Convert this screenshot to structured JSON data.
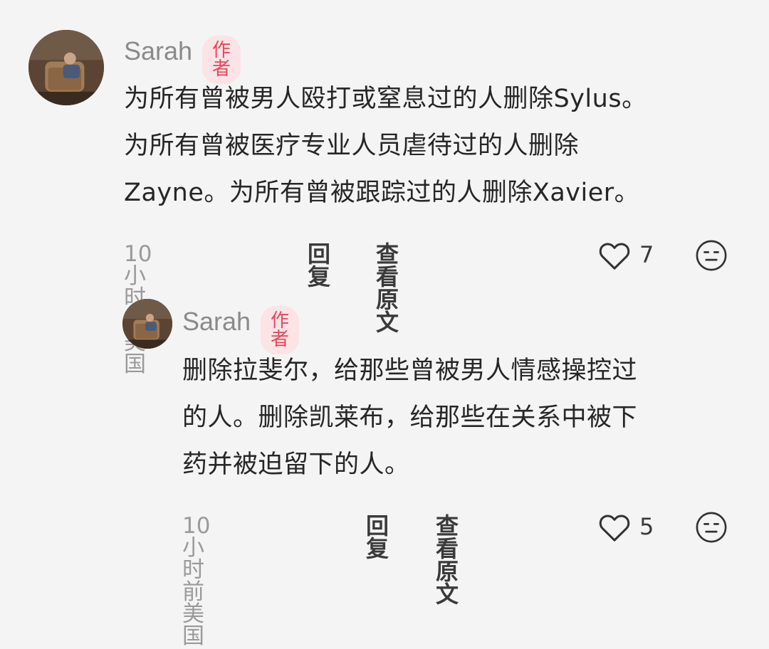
{
  "comments": [
    {
      "author": "Sarah",
      "badge": "作者",
      "text": "为所有曾被男人殴打或窒息过的人删除Sylus。\n为所有曾被医疗专业人员虐待过的人删除\nZayne。为所有曾被跟踪过的人删除Xavier。",
      "meta": "10小时前 美国",
      "reply_label": "回复",
      "view_original_label": "查看原文",
      "likes": "7"
    },
    {
      "author": "Sarah",
      "badge": "作者",
      "text": "删除拉斐尔，给那些曾被男人情感操控过\n的人。删除凯莱布，给那些在关系中被下\n药并被迫留下的人。",
      "meta": "10小时前 美国",
      "reply_label": "回复",
      "view_original_label": "查看原文",
      "likes": "5"
    }
  ],
  "icons": {
    "like": "heart-outline-icon",
    "react": "smiley-face-icon"
  },
  "colors": {
    "badge_bg": "#fbe3e6",
    "badge_text": "#e0495b",
    "meta_text": "#9a9a9a"
  }
}
